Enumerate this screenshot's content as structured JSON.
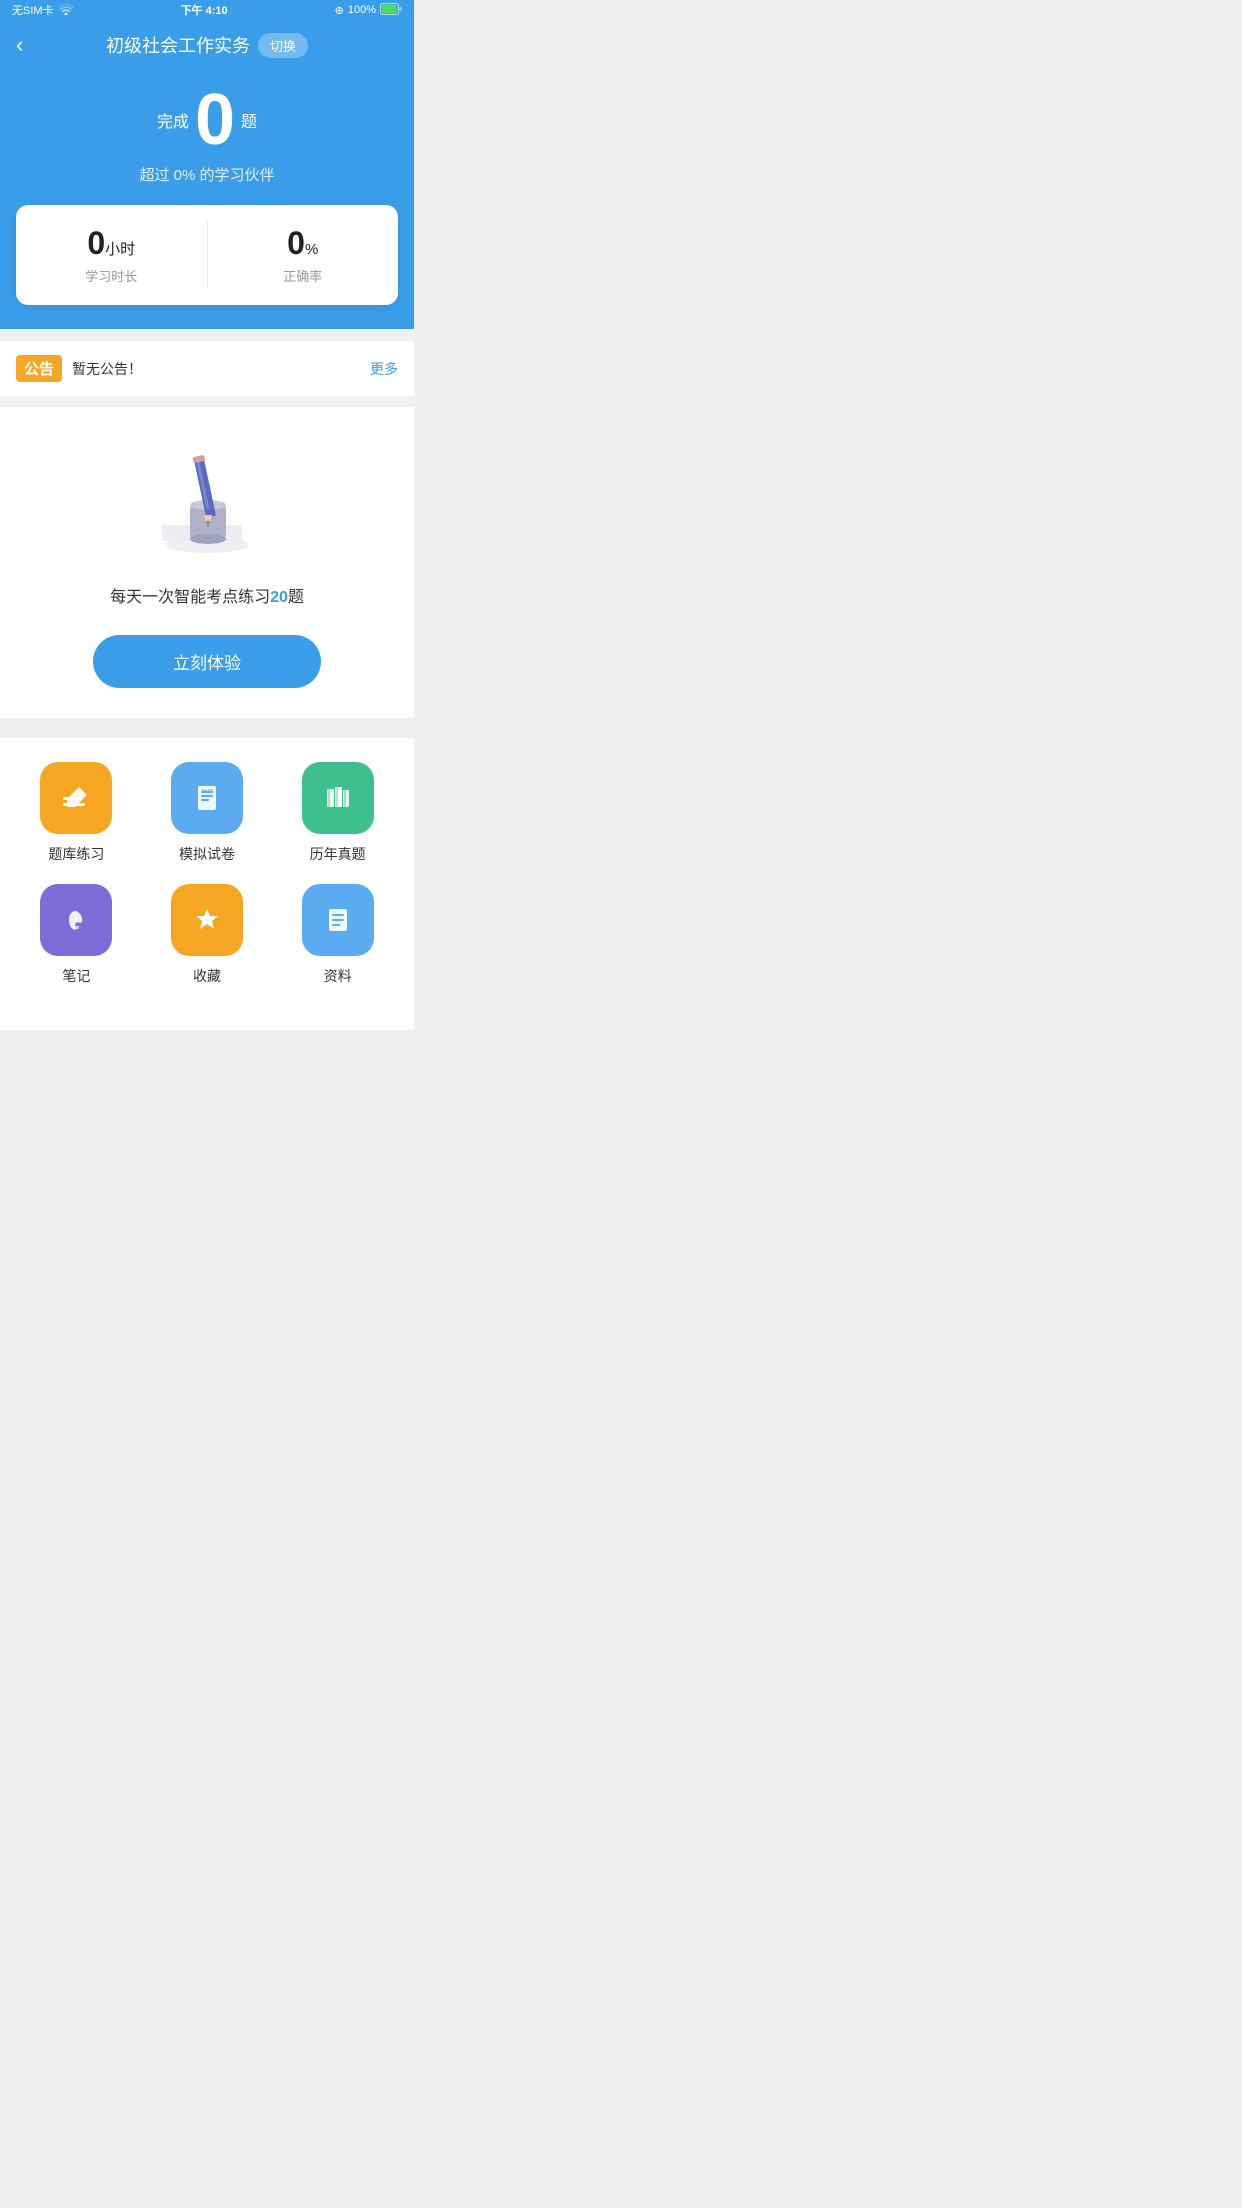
{
  "statusBar": {
    "left": "无SIM卡 ▲",
    "center": "下午 4:10",
    "rightSignal": "⊕",
    "rightPercent": "100%",
    "rightBattery": "🔋"
  },
  "header": {
    "backLabel": "‹",
    "title": "初级社会工作实务",
    "switchLabel": "切换"
  },
  "hero": {
    "completedPrefix": "完成",
    "completedCount": "0",
    "completedSuffix": "题",
    "surpassText": "超过 0% 的学习伙伴"
  },
  "stats": {
    "studyHours": "0",
    "studyHoursUnit": "小时",
    "studyLabel": "学习时长",
    "accuracy": "0",
    "accuracyUnit": "%",
    "accuracyLabel": "正确率"
  },
  "announcement": {
    "badge": "公告",
    "text": "暂无公告！",
    "more": "更多"
  },
  "daily": {
    "description": "每天一次智能考点练习",
    "highlight": "20",
    "highlightSuffix": "题",
    "buttonLabel": "立刻体验"
  },
  "menu": {
    "items": [
      {
        "label": "题库练习",
        "colorClass": "icon-orange",
        "icon": "✏️"
      },
      {
        "label": "模拟试卷",
        "colorClass": "icon-blue-light",
        "icon": "📋"
      },
      {
        "label": "历年真题",
        "colorClass": "icon-teal",
        "icon": "📚"
      },
      {
        "label": "笔记",
        "colorClass": "icon-purple",
        "icon": "✒️"
      },
      {
        "label": "收藏",
        "colorClass": "icon-orange2",
        "icon": "⭐"
      },
      {
        "label": "资料",
        "colorClass": "icon-blue2",
        "icon": "📄"
      }
    ]
  }
}
